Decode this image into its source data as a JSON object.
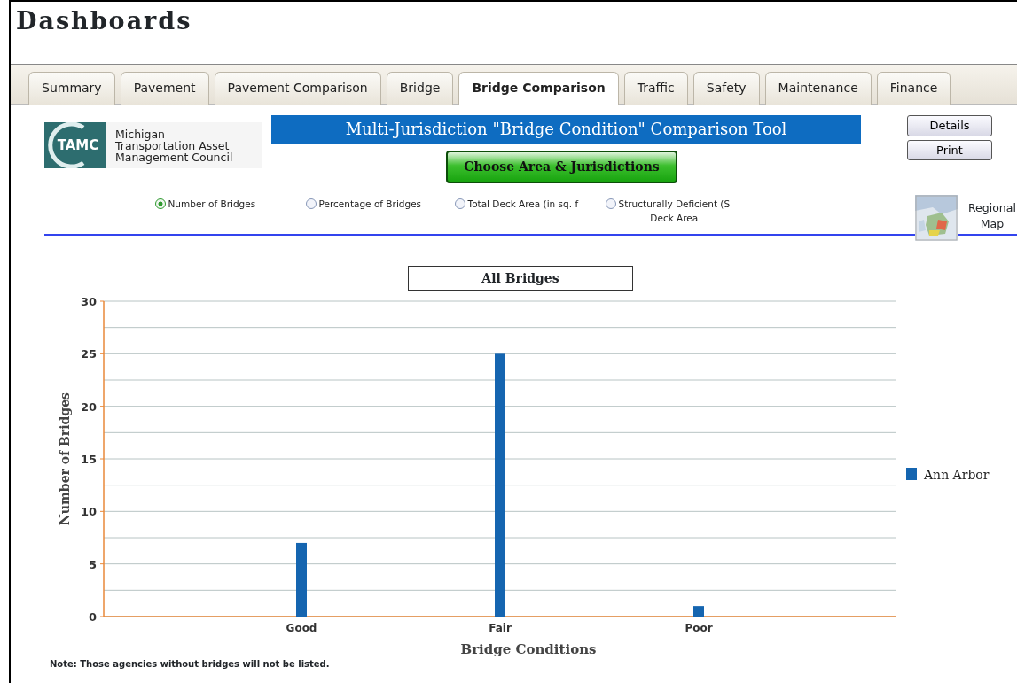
{
  "page_title": "Dashboards",
  "tabs": [
    {
      "label": "Summary",
      "selected": false
    },
    {
      "label": "Pavement",
      "selected": false
    },
    {
      "label": "Pavement Comparison",
      "selected": false
    },
    {
      "label": "Bridge",
      "selected": false
    },
    {
      "label": "Bridge Comparison",
      "selected": true
    },
    {
      "label": "Traffic",
      "selected": false
    },
    {
      "label": "Safety",
      "selected": false
    },
    {
      "label": "Maintenance",
      "selected": false
    },
    {
      "label": "Finance",
      "selected": false
    }
  ],
  "logo": {
    "mark": "TAMC",
    "lines": [
      "Michigan",
      "Transportation Asset",
      "Management Council"
    ]
  },
  "tool_title": "Multi-Jurisdiction \"Bridge Condition\" Comparison Tool",
  "choose_button": "Choose Area & Jurisdictions",
  "buttons": [
    "Details",
    "Print"
  ],
  "map_link": {
    "lines": [
      "Regional",
      "Map"
    ]
  },
  "measures": [
    {
      "lines": [
        "Number of Bridges"
      ],
      "selected": true
    },
    {
      "lines": [
        "Percentage of Bridges"
      ],
      "selected": false
    },
    {
      "lines": [
        "Total Deck Area (in sq. f"
      ],
      "selected": false
    },
    {
      "lines": [
        "Structurally Deficient (S",
        "Deck Area"
      ],
      "selected": false
    }
  ],
  "chart": {
    "chart_data": {
      "type": "bar",
      "title": "All Bridges",
      "xlabel": "Bridge Conditions",
      "ylabel": "Number of Bridges",
      "categories": [
        "Good",
        "Fair",
        "Poor"
      ],
      "series": [
        {
          "name": "Ann Arbor",
          "color": "#1565b0",
          "values": [
            7,
            25,
            1
          ]
        }
      ],
      "grid": true,
      "ylim": [
        0,
        30
      ],
      "yticks": [
        0,
        5,
        10,
        15,
        20,
        25,
        30
      ]
    }
  },
  "note": "Note: Those agencies without bridges will not be listed."
}
